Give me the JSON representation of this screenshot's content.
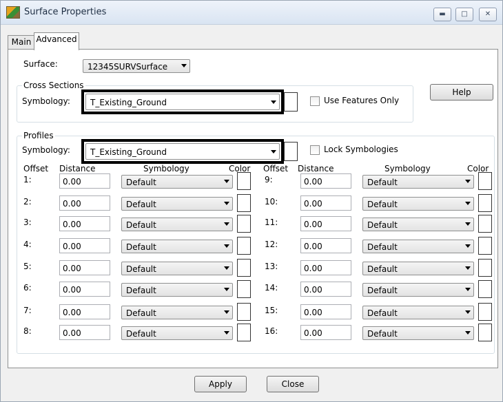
{
  "window": {
    "title": "Surface Properties"
  },
  "tabs": [
    "Main",
    "Advanced"
  ],
  "surface": {
    "label": "Surface:",
    "value": "12345SURVSurface"
  },
  "cross_sections": {
    "group_title": "Cross Sections",
    "symbology_label": "Symbology:",
    "symbology_value": "T_Existing_Ground",
    "checkbox_label": "Use Features Only",
    "checked": false
  },
  "help_button": "Help",
  "profiles": {
    "group_title": "Profiles",
    "symbology_label": "Symbology:",
    "symbology_value": "T_Existing_Ground",
    "checkbox_label": "Lock Symbologies",
    "checked": false,
    "headers": {
      "offset": "Offset",
      "distance": "Distance",
      "symbology": "Symbology",
      "color": "Color"
    },
    "rows": [
      {
        "num": "1:",
        "distance": "0.00",
        "symbology": "Default"
      },
      {
        "num": "2:",
        "distance": "0.00",
        "symbology": "Default"
      },
      {
        "num": "3:",
        "distance": "0.00",
        "symbology": "Default"
      },
      {
        "num": "4:",
        "distance": "0.00",
        "symbology": "Default"
      },
      {
        "num": "5:",
        "distance": "0.00",
        "symbology": "Default"
      },
      {
        "num": "6:",
        "distance": "0.00",
        "symbology": "Default"
      },
      {
        "num": "7:",
        "distance": "0.00",
        "symbology": "Default"
      },
      {
        "num": "8:",
        "distance": "0.00",
        "symbology": "Default"
      },
      {
        "num": "9:",
        "distance": "0.00",
        "symbology": "Default"
      },
      {
        "num": "10:",
        "distance": "0.00",
        "symbology": "Default"
      },
      {
        "num": "11:",
        "distance": "0.00",
        "symbology": "Default"
      },
      {
        "num": "12:",
        "distance": "0.00",
        "symbology": "Default"
      },
      {
        "num": "13:",
        "distance": "0.00",
        "symbology": "Default"
      },
      {
        "num": "14:",
        "distance": "0.00",
        "symbology": "Default"
      },
      {
        "num": "15:",
        "distance": "0.00",
        "symbology": "Default"
      },
      {
        "num": "16:",
        "distance": "0.00",
        "symbology": "Default"
      }
    ]
  },
  "buttons": {
    "apply": "Apply",
    "close": "Close"
  },
  "icons": [
    "minimize-icon",
    "maximize-icon",
    "close-icon",
    "dropdown-arrow-icon"
  ]
}
